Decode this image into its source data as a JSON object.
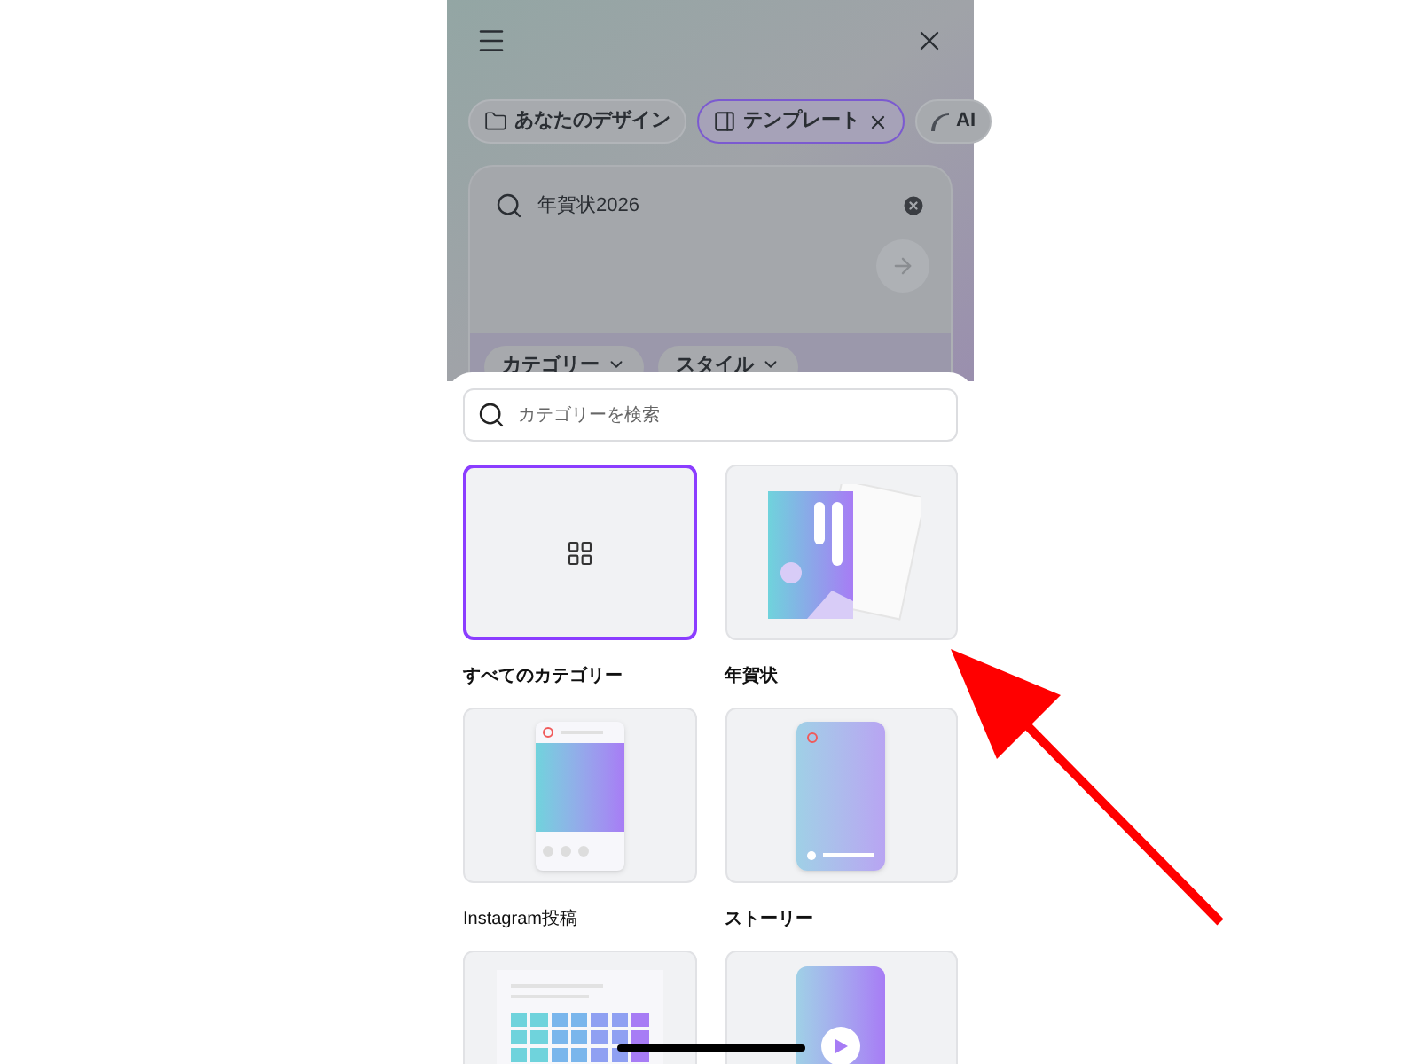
{
  "top_chips": [
    {
      "label": "あなたのデザイン",
      "kind": "folder",
      "selected": false
    },
    {
      "label": "テンプレート",
      "kind": "template",
      "selected": true
    },
    {
      "label": "AI",
      "kind": "ai",
      "selected": false
    }
  ],
  "search": {
    "value": "年賀状2026"
  },
  "filters": [
    {
      "label": "カテゴリー"
    },
    {
      "label": "スタイル"
    }
  ],
  "sheet": {
    "search": {
      "placeholder": "カテゴリーを検索"
    },
    "categories": [
      {
        "label": "すべてのカテゴリー",
        "kind": "all",
        "selected": true
      },
      {
        "label": "年賀状",
        "kind": "card",
        "selected": false
      },
      {
        "label": "Instagram投稿",
        "kind": "post",
        "selected": false
      },
      {
        "label": "ストーリー",
        "kind": "story",
        "selected": false
      },
      {
        "kind": "calendar",
        "selected": false
      },
      {
        "kind": "video",
        "selected": false
      }
    ]
  }
}
